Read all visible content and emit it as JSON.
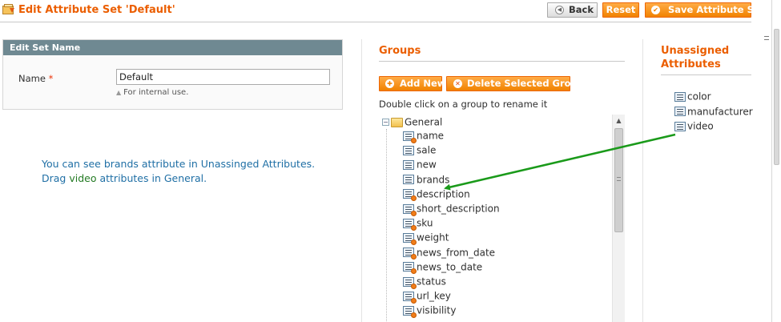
{
  "header": {
    "title": "Edit Attribute Set 'Default'",
    "back_label": "Back",
    "reset_label": "Reset",
    "save_label": "Save Attribute Set"
  },
  "edit_set_name": {
    "section_title": "Edit Set Name",
    "name_label": "Name",
    "required_mark": "*",
    "name_value": "Default",
    "hint": "For internal use."
  },
  "note": {
    "line1": "You can see brands attribute in Unassinged Attributes.",
    "line2_before": "Drag ",
    "line2_highlight": "video",
    "line2_after": " attributes in General."
  },
  "groups": {
    "title": "Groups",
    "add_label": "Add New",
    "delete_label": "Delete Selected Group",
    "hint": "Double click on a group to rename it",
    "tree": {
      "root": "General",
      "items": [
        "name",
        "sale",
        "new",
        "brands",
        "description",
        "short_description",
        "sku",
        "weight",
        "news_from_date",
        "news_to_date",
        "status",
        "url_key",
        "visibility"
      ],
      "system_flags": [
        true,
        false,
        false,
        false,
        true,
        true,
        true,
        true,
        true,
        true,
        true,
        true,
        true
      ]
    }
  },
  "unassigned": {
    "title_line1": "Unassigned",
    "title_line2": "Attributes",
    "items": [
      "color",
      "manufacturer",
      "video"
    ]
  },
  "colors": {
    "accent": "#eb5e00",
    "note_text": "#1f6fa5",
    "highlight": "#237a23",
    "drag_arrow": "#1a9a1a"
  },
  "icons": {
    "title": "attribute-set-icon",
    "back": "back-arrow-icon",
    "save": "save-check-icon",
    "add": "plus-icon",
    "delete": "delete-icon",
    "tree_root": "folder-icon",
    "tree_item": "attribute-icon"
  }
}
